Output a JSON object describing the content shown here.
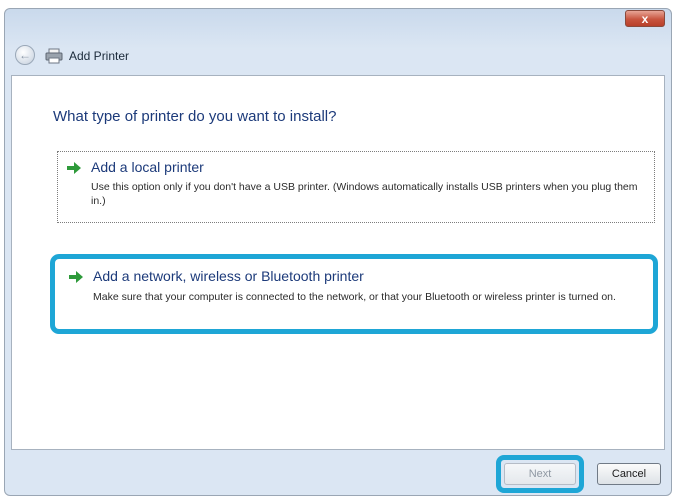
{
  "window": {
    "title": "Add Printer",
    "close_label": "x"
  },
  "back_button": {
    "glyph": "←"
  },
  "main": {
    "heading": "What type of printer do you want to install?",
    "options": [
      {
        "title": "Add a local printer",
        "description": "Use this option only if you don't have a USB printer. (Windows automatically installs USB printers when you plug them in.)"
      },
      {
        "title": "Add a network, wireless or Bluetooth printer",
        "description": "Make sure that your computer is connected to the network, or that your Bluetooth or wireless printer is turned on."
      }
    ]
  },
  "footer": {
    "next_label": "Next",
    "cancel_label": "Cancel"
  },
  "colors": {
    "highlight": "#1ea6d6",
    "heading_text": "#1c3a7a",
    "arrow_green": "#2e9a3a"
  },
  "icons": [
    "back-arrow-icon",
    "printer-icon",
    "green-arrow-icon",
    "close-icon"
  ]
}
